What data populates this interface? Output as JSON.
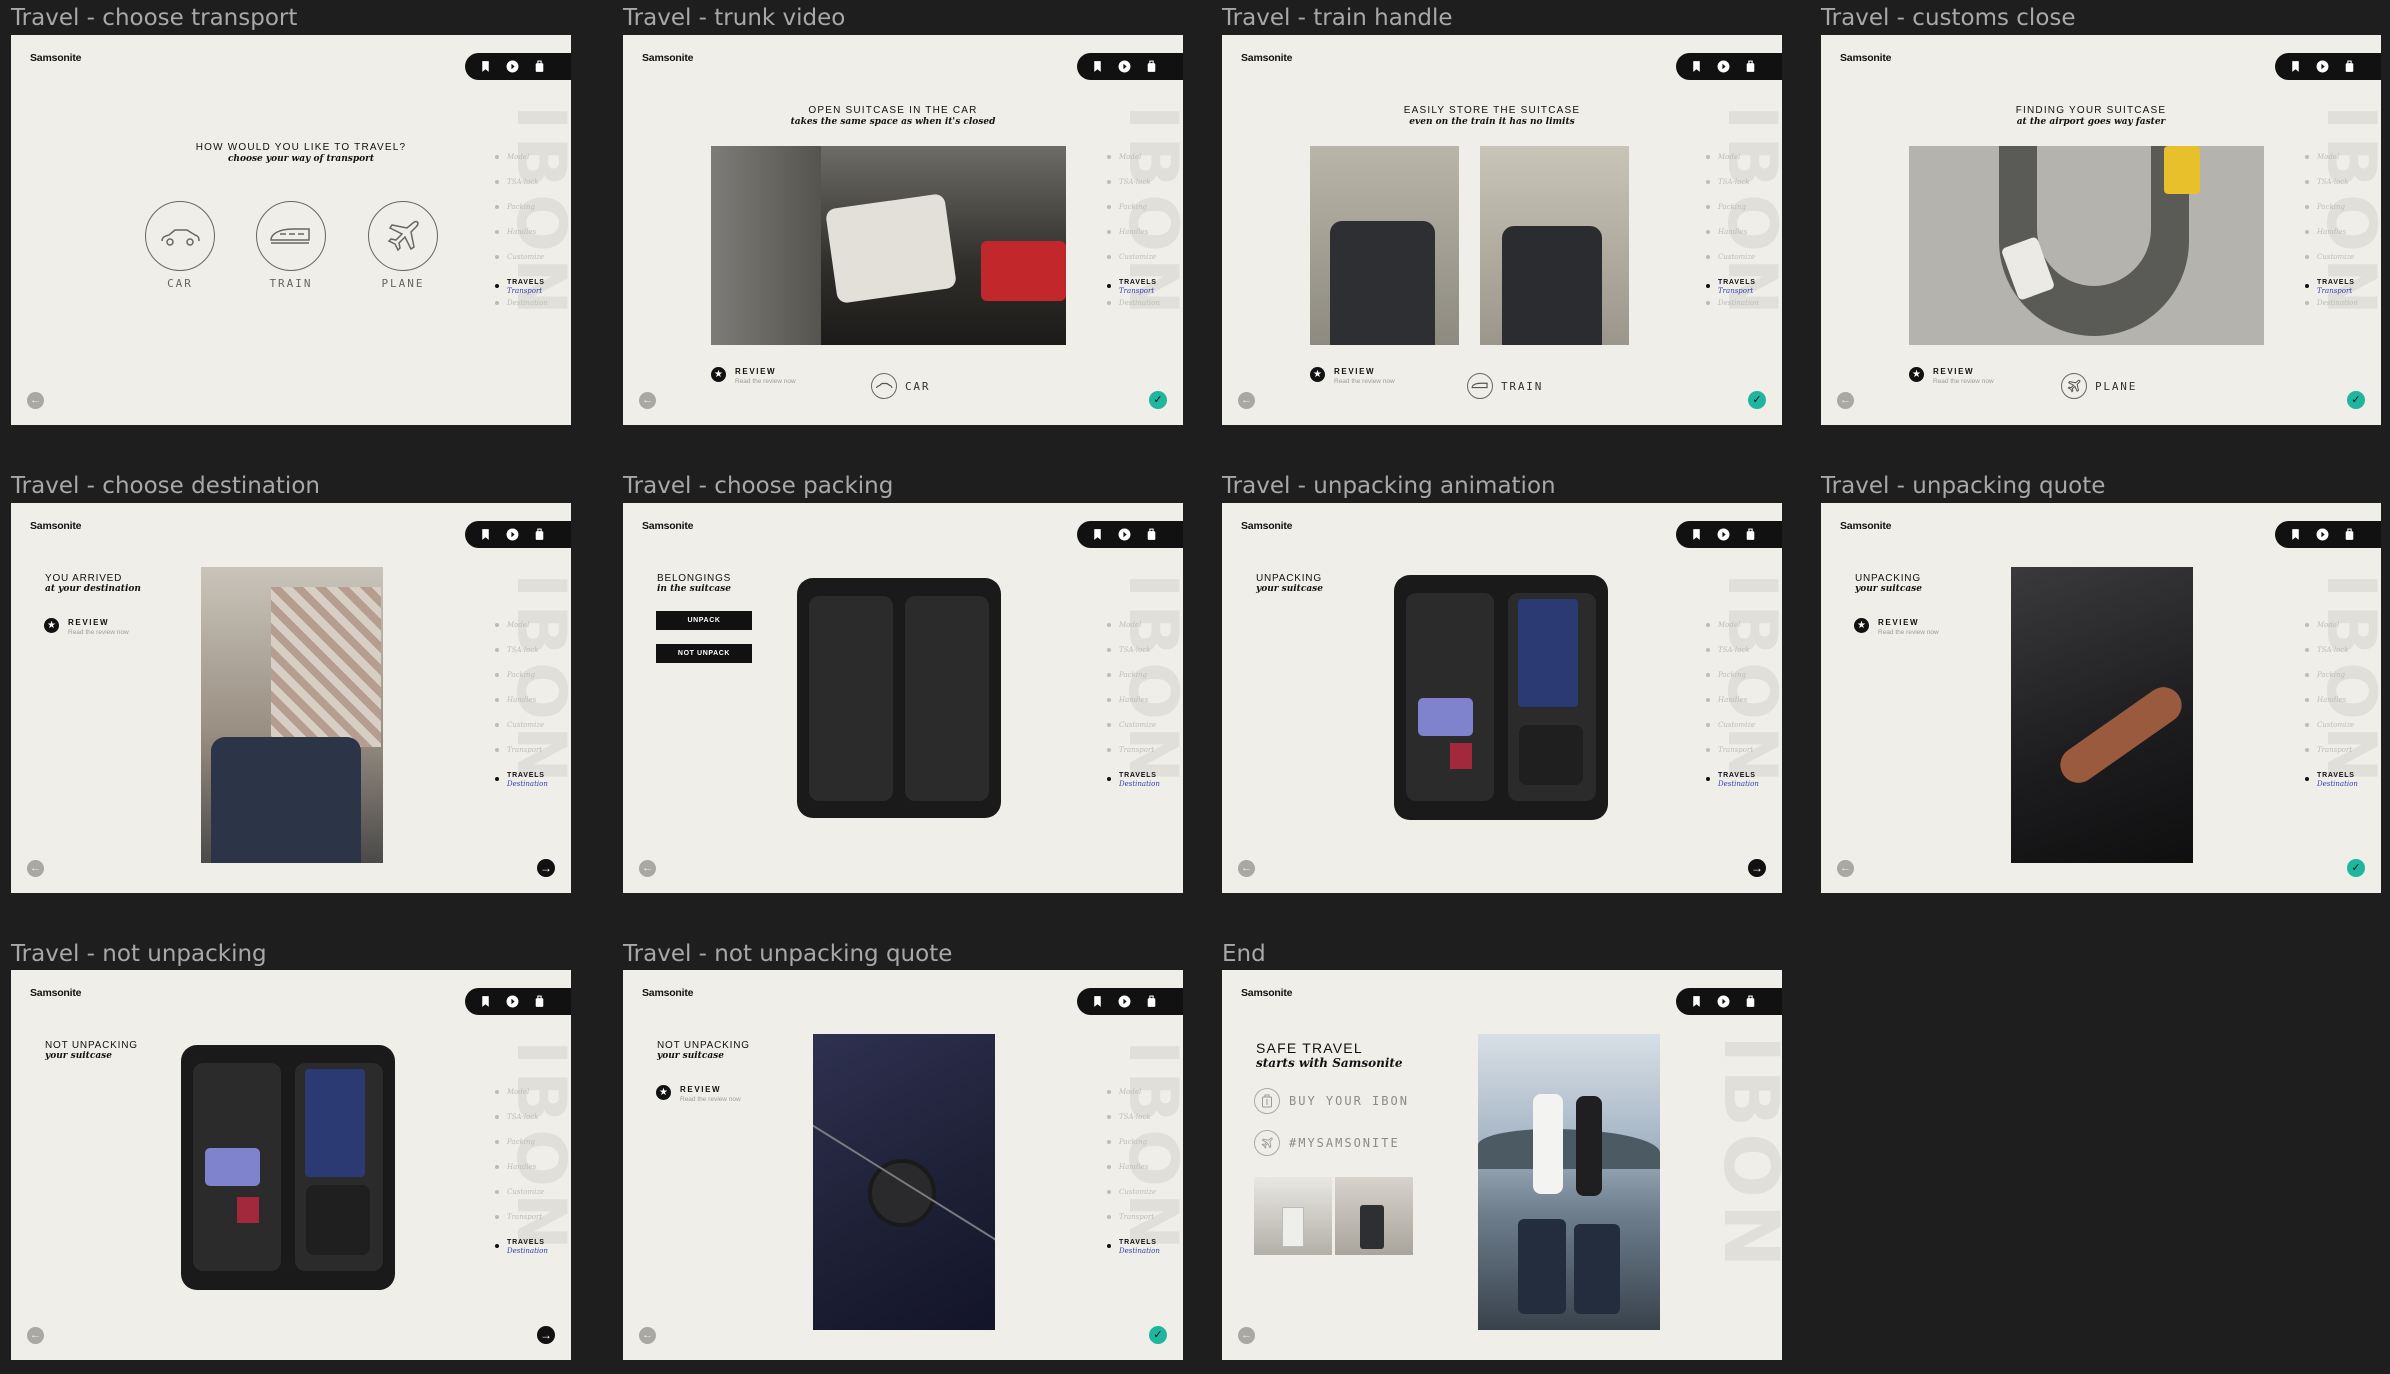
{
  "brand": "Samsonite",
  "frames": {
    "f1": {
      "title": "Travel - choose transport",
      "question": "HOW WOULD YOU LIKE TO TRAVEL?",
      "sub": "choose your way of transport",
      "options": [
        "CAR",
        "TRAIN",
        "PLANE"
      ]
    },
    "f2": {
      "title": "Travel - trunk video",
      "head": "OPEN SUITCASE IN THE CAR",
      "sub": "takes the same space as when it's closed",
      "transport": "CAR"
    },
    "f3": {
      "title": "Travel - train handle",
      "head": "EASILY STORE THE SUITCASE",
      "sub": "even on the train it has no limits",
      "transport": "TRAIN"
    },
    "f4": {
      "title": "Travel - customs close",
      "head": "FINDING YOUR SUITCASE",
      "sub": "at the airport goes way faster",
      "transport": "PLANE"
    },
    "f5": {
      "title": "Travel - choose destination",
      "head": "YOU ARRIVED",
      "sub": "at your destination"
    },
    "f6": {
      "title": "Travel - choose packing",
      "head": "BELONGINGS",
      "sub": "in the suitcase",
      "btn1": "UNPACK",
      "btn2": "NOT UNPACK"
    },
    "f7": {
      "title": "Travel - unpacking animation",
      "head": "UNPACKING",
      "sub": "your suitcase"
    },
    "f8": {
      "title": "Travel - unpacking quote",
      "head": "UNPACKING",
      "sub": "your suitcase"
    },
    "f9": {
      "title": "Travel - not unpacking",
      "head": "NOT UNPACKING",
      "sub": "your suitcase"
    },
    "f10": {
      "title": "Travel - not unpacking quote",
      "head": "NOT UNPACKING",
      "sub": "your suitcase"
    },
    "f11": {
      "title": "End",
      "head": "SAFE TRAVEL",
      "sub": "starts with Samsonite",
      "link1": "BUY YOUR IBON",
      "link2": "#MYSAMSONITE"
    }
  },
  "review": {
    "label": "REVIEW",
    "sub": "Read the review now"
  },
  "nav": {
    "items": [
      "Model",
      "TSA-lock",
      "Packing",
      "Handles",
      "Customize"
    ],
    "transport_item": "Transport",
    "travels": "TRAVELS",
    "destination": "Destination"
  },
  "watermark": "IBON",
  "colors": {
    "background": "#1e1e1e",
    "frame": "#efeee9",
    "accent_blue": "#3140b8",
    "accent_teal": "#1fb59e"
  }
}
